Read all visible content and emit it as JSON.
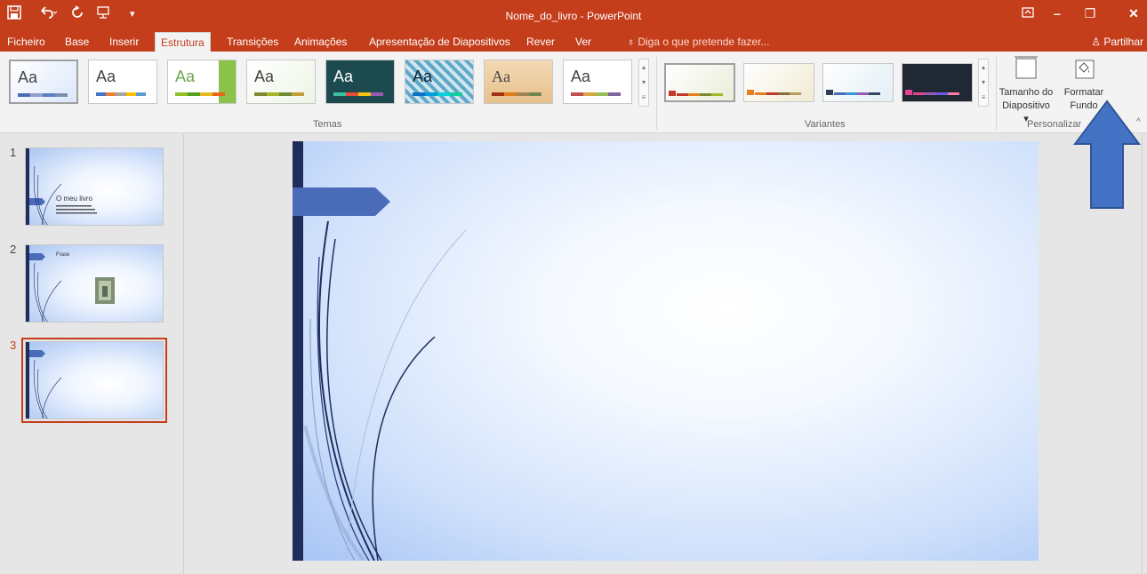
{
  "window": {
    "title": "Nome_do_livro - PowerPoint",
    "minimize_glyph": "–",
    "restore_glyph": "❐",
    "close_glyph": "✕"
  },
  "quick_access": {
    "save_icon": "save-icon",
    "undo_icon": "undo-icon",
    "redo_icon": "redo-icon",
    "start_presentation_icon": "presentation-icon",
    "customize_icon": "customize-icon"
  },
  "tabs": [
    {
      "label": "Ficheiro"
    },
    {
      "label": "Base"
    },
    {
      "label": "Inserir"
    },
    {
      "label": "Estrutura",
      "active": true
    },
    {
      "label": "Transições"
    },
    {
      "label": "Animações"
    },
    {
      "label": "Apresentação de Diapositivos"
    },
    {
      "label": "Rever"
    },
    {
      "label": "Ver"
    }
  ],
  "tell_me": "Diga o que pretende fazer...",
  "share": "Partilhar",
  "ribbon": {
    "themes_label": "Temas",
    "variants_label": "Variantes",
    "customize_label": "Personalizar",
    "theme_sample": "Aa",
    "slide_size_line1": "Tamanho do",
    "slide_size_line2": "Diapositivo ▾",
    "format_bg_line1": "Formatar",
    "format_bg_line2": "Fundo"
  },
  "slides": [
    {
      "number": "1",
      "title": "O meu livro"
    },
    {
      "number": "2",
      "title": "Frase"
    },
    {
      "number": "3",
      "title": ""
    }
  ],
  "colors": {
    "accent": "#c43e1c",
    "arrow": "#4472c4",
    "slide_bar": "#1f2d5c",
    "slide_tab": "#4a6bb8"
  }
}
